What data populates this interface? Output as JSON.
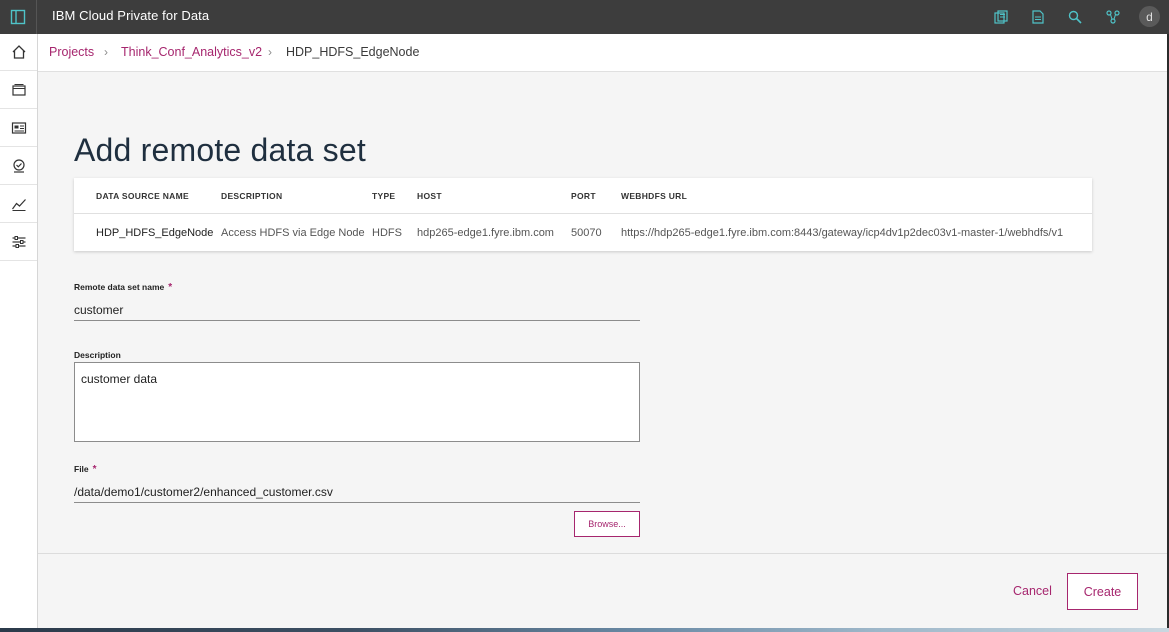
{
  "app": {
    "title": "IBM Cloud Private for Data",
    "user_initial": "d",
    "accent_color": "#a6266e",
    "header_icons": [
      "catalog-icon",
      "document-icon",
      "search-icon",
      "collaborators-icon"
    ]
  },
  "leftnav": {
    "items": [
      "home-icon",
      "projects-icon",
      "catalog-icon",
      "badge-icon",
      "analytics-icon",
      "settings-sliders-icon"
    ]
  },
  "breadcrumb": {
    "items": [
      "Projects",
      "Think_Conf_Analytics_v2"
    ],
    "current": "HDP_HDFS_EdgeNode"
  },
  "page": {
    "title": "Add remote data set"
  },
  "datasource": {
    "columns": [
      "DATA SOURCE NAME",
      "DESCRIPTION",
      "TYPE",
      "HOST",
      "PORT",
      "WEBHDFS URL"
    ],
    "row": {
      "name": "HDP_HDFS_EdgeNode",
      "description": "Access HDFS via Edge Node",
      "type": "HDFS",
      "host": "hdp265-edge1.fyre.ibm.com",
      "port": "50070",
      "url": "https://hdp265-edge1.fyre.ibm.com:8443/gateway/icp4dv1p2dec03v1-master-1/webhdfs/v1"
    }
  },
  "form": {
    "name_label": "Remote data set name",
    "name_value": "customer",
    "description_label": "Description",
    "description_value": "customer data",
    "file_label": "File",
    "file_value": "/data/demo1/customer2/enhanced_customer.csv",
    "required_mark": "*",
    "browse_label": "Browse..."
  },
  "footer": {
    "cancel_label": "Cancel",
    "create_label": "Create"
  }
}
